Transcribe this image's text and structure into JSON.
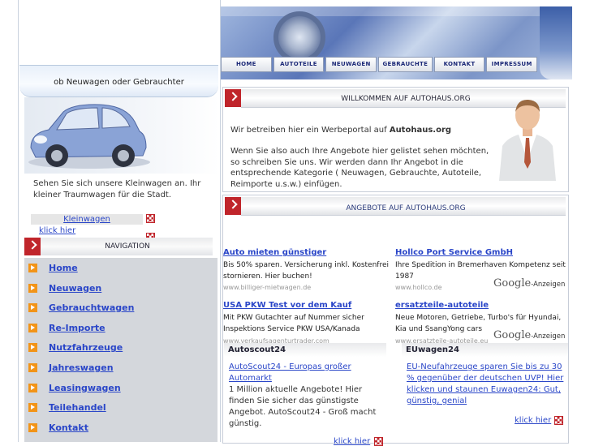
{
  "sidebar": {
    "tagline": "ob Neuwagen oder Gebrauchter",
    "car_description": "Sehen Sie sich unsere Kleinwagen an. Ihr kleiner Traumwagen für die Stadt.",
    "kleinwagen_link": "Kleinwagen",
    "klick_hier": "klick hier",
    "nav_title": "NAVIGATION",
    "nav_items": [
      "Home",
      "Neuwagen",
      "Gebrauchtwagen",
      "Re-Importe",
      "Nutzfahrzeuge",
      "Jahreswagen",
      "Leasingwagen",
      "Teilehandel",
      "Kontakt"
    ]
  },
  "header": {
    "menu": [
      "HOME",
      "AUTOTEILE",
      "NEUWAGEN",
      "GEBRAUCHTE",
      "KONTAKT",
      "IMPRESSUM"
    ]
  },
  "welcome": {
    "title": "WILLKOMMEN AUF AUTOHAUS.ORG",
    "p1_prefix": "Wir betreiben hier ein Werbeportal auf ",
    "p1_bold": "Autohaus.org",
    "p2": "Wenn Sie also auch Ihre Angebote hier gelistet sehen möchten, so schreiben Sie uns. Wir werden dann Ihr Angebot in die entsprechende Kategorie ( Neuwagen, Gebrauchte, Autoteile, Reimporte u.s.w.) einfügen."
  },
  "angebote": {
    "title": "ANGEBOTE AUF AUTOHAUS.ORG",
    "google_label": "-Anzeigen",
    "google_brand": "Google",
    "ads": [
      {
        "title": "Auto mieten günstiger",
        "text": "Bis 50% sparen. Versicherung inkl. Kostenfrei stornieren. Hier buchen!",
        "url": "www.billiger-mietwagen.de"
      },
      {
        "title": "Hollco Port Service GmbH",
        "text": "Ihre Spedition in Bremerhaven Kompetenz seit 1987",
        "url": "www.hollco.de"
      },
      {
        "title": "USA PKW Test vor dem Kauf",
        "text": "Mit PKW Gutachter auf Nummer sicher Inspektions Service PKW USA/Kanada",
        "url": "www.verkaufsagenturtrader.com"
      },
      {
        "title": "ersatzteile-autoteile",
        "text": "Neue Motoren, Getriebe, Turbo's für Hyundai, Kia und SsangYong cars",
        "url": "www.ersatzteile-autoteile.eu"
      }
    ],
    "autoscout": {
      "header": "Autoscout24",
      "link": "AutoScout24 - Europas großer Automarkt",
      "text": "1 Million aktuelle Angebote! Hier finden Sie sicher das günstigste Angebot. AutoScout24 - Groß macht günstig.",
      "klick": "klick hier"
    },
    "euwagen": {
      "header": "EUwagen24",
      "link": "EU-Neufahrzeuge sparen Sie bis zu 30 % gegenüber der deutschen UVP! Hier klicken und staunen Euwagen24: Gut, günstig, genial",
      "klick": "klick hier"
    }
  },
  "colors": {
    "accent_red": "#c0252b",
    "link_blue": "#2a46c8",
    "nav_bg": "#d4d7dc",
    "nav_icon": "#f29418"
  }
}
